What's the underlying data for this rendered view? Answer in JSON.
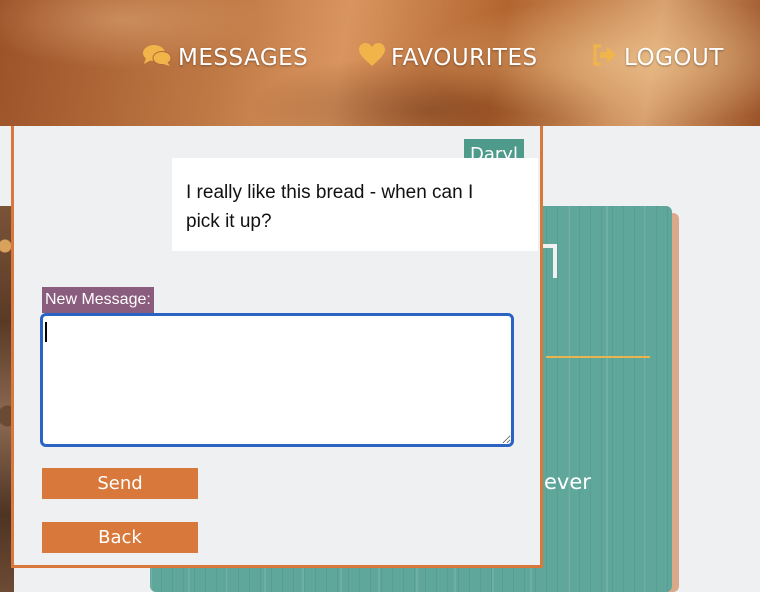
{
  "nav": {
    "messages": {
      "label": "MESSAGES",
      "icon": "chat-bubbles-icon"
    },
    "favourites": {
      "label": "FAVOURITES",
      "icon": "heart-icon"
    },
    "logout": {
      "label": "LOGOUT",
      "icon": "logout-icon"
    }
  },
  "colors": {
    "accent": "#d8783a",
    "icon": "#f0b54a",
    "sender_tag": "#4e9b8c",
    "label_bg": "#8a5c7e",
    "focus_border": "#2a63c4"
  },
  "conversation": {
    "messages": [
      {
        "sender": "Daryl",
        "text": "I really like this bread - when can I pick it up?"
      }
    ]
  },
  "compose": {
    "label": "New Message:",
    "value": "",
    "send_label": "Send",
    "back_label": "Back"
  },
  "background_card": {
    "partial_text": "ever"
  }
}
